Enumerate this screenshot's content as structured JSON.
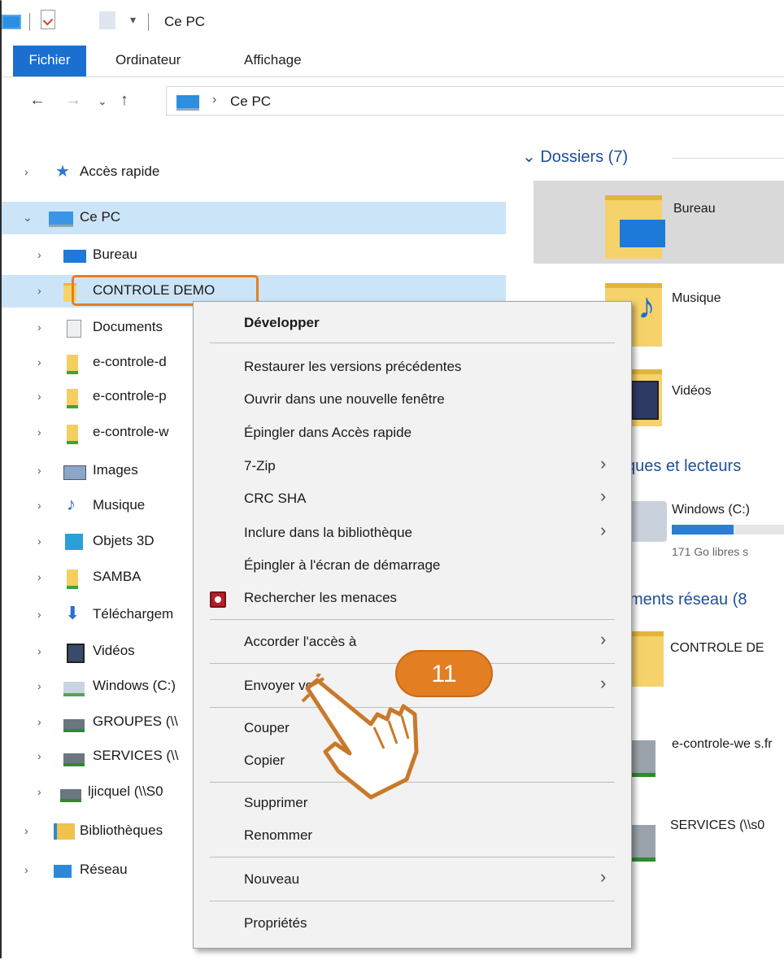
{
  "window": {
    "title": "Ce PC"
  },
  "ribbon": {
    "tabs": [
      "Fichier",
      "Ordinateur",
      "Affichage"
    ]
  },
  "address": {
    "path_label": "Ce PC",
    "separator": "›"
  },
  "nav": {
    "back": "←",
    "forward": "→",
    "recent": "⌄",
    "up": "↑"
  },
  "tree": {
    "items": [
      {
        "label": "Accès rapide"
      },
      {
        "label": "Ce PC"
      },
      {
        "label": "Bureau"
      },
      {
        "label": "CONTROLE DEMO"
      },
      {
        "label": "Documents"
      },
      {
        "label": "e-controle-d"
      },
      {
        "label": "e-controle-p"
      },
      {
        "label": "e-controle-w"
      },
      {
        "label": "Images"
      },
      {
        "label": "Musique"
      },
      {
        "label": "Objets 3D"
      },
      {
        "label": "SAMBA"
      },
      {
        "label": "Téléchargem"
      },
      {
        "label": "Vidéos"
      },
      {
        "label": "Windows (C:)"
      },
      {
        "label": "GROUPES (\\\\"
      },
      {
        "label": "SERVICES (\\\\"
      },
      {
        "label": "ljicquel (\\\\S0"
      },
      {
        "label": "Bibliothèques"
      },
      {
        "label": "Réseau"
      }
    ]
  },
  "content": {
    "section_folders": "Dossiers (7)",
    "folders": [
      {
        "label": "Bureau"
      },
      {
        "label": "Musique"
      },
      {
        "label": "Vidéos"
      }
    ],
    "section_devices": "ques et lecteurs",
    "drive": {
      "label": "Windows (C:)",
      "free": "171 Go libres s",
      "usage_fraction": 0.55
    },
    "section_network": "ments réseau (8",
    "network": [
      {
        "label": "CONTROLE DE"
      },
      {
        "label": "e-controle-we s.fr"
      },
      {
        "label": "SERVICES (\\\\s0"
      }
    ]
  },
  "context_menu": {
    "items": [
      {
        "label": "Développer"
      },
      {
        "label": "Restaurer les versions précédentes"
      },
      {
        "label": "Ouvrir dans une nouvelle fenêtre"
      },
      {
        "label": "Épingler dans Accès rapide"
      },
      {
        "label": "7-Zip"
      },
      {
        "label": "CRC SHA"
      },
      {
        "label": "Inclure dans la bibliothèque"
      },
      {
        "label": "Épingler à l'écran de démarrage"
      },
      {
        "label": "Rechercher les menaces"
      },
      {
        "label": "Accorder l'accès à"
      },
      {
        "label": "Envoyer vers"
      },
      {
        "label": "Couper"
      },
      {
        "label": "Copier"
      },
      {
        "label": "Supprimer"
      },
      {
        "label": "Renommer"
      },
      {
        "label": "Nouveau"
      },
      {
        "label": "Propriétés"
      }
    ],
    "submenu_arrow": "›"
  },
  "annotation": {
    "step": "11"
  },
  "colors": {
    "accent": "#1a6fd0",
    "selection": "#cce4f7",
    "highlight": "#e67e22"
  }
}
